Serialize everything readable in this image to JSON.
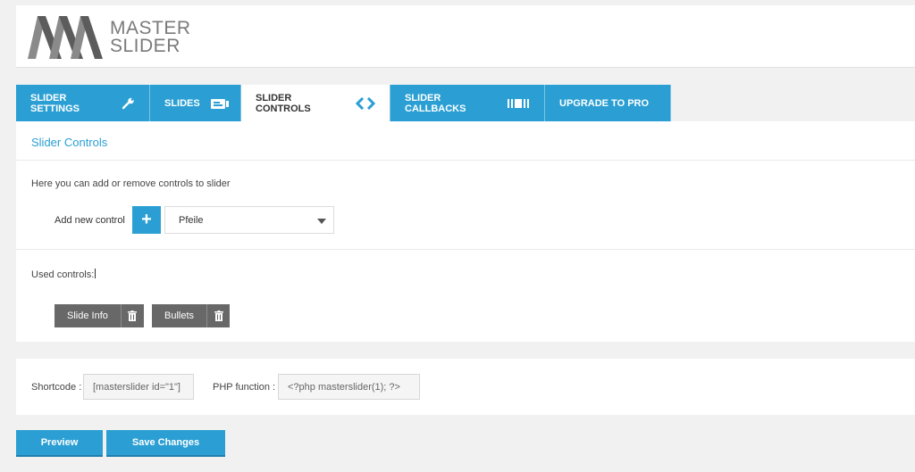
{
  "brand": {
    "line1": "MASTER",
    "line2": "SLIDER"
  },
  "tabs": [
    {
      "label": "SLIDER SETTINGS",
      "icon": "wrench-icon",
      "active": false
    },
    {
      "label": "SLIDES",
      "icon": "slides-icon",
      "active": false
    },
    {
      "label": "SLIDER CONTROLS",
      "icon": "arrows-icon",
      "active": true
    },
    {
      "label": "SLIDER CALLBACKS",
      "icon": "callbacks-icon",
      "active": false
    },
    {
      "label": "UPGRADE TO PRO",
      "icon": "",
      "active": false
    }
  ],
  "controls_panel": {
    "title": "Slider Controls",
    "description": "Here you can add or remove controls to slider",
    "add_label": "Add new control",
    "add_button": "+",
    "select_value": "Pfeile",
    "used_label": "Used controls:",
    "used_controls": [
      "Slide Info",
      "Bullets"
    ]
  },
  "shortcode": {
    "label": "Shortcode :",
    "value": "[masterslider id=\"1\"]",
    "php_label": "PHP function :",
    "php_value": "<?php masterslider(1); ?>"
  },
  "actions": {
    "preview": "Preview",
    "save": "Save Changes"
  },
  "colors": {
    "accent": "#2b9fd3",
    "control_bg": "#686868",
    "page_bg": "#f1f1f1"
  }
}
